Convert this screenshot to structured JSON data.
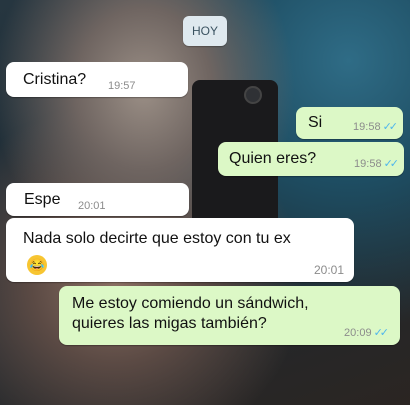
{
  "chat": {
    "date_chip": "HOY",
    "messages": [
      {
        "text": "Cristina?",
        "time": "19:57",
        "direction": "incoming"
      },
      {
        "text": "Si",
        "time": "19:58",
        "direction": "outgoing",
        "ticks": "read"
      },
      {
        "text": "Quien eres?",
        "time": "19:58",
        "direction": "outgoing",
        "ticks": "read"
      },
      {
        "text": "Espe",
        "time": "20:01",
        "direction": "incoming"
      },
      {
        "text": "Nada solo decirte que estoy con tu ex",
        "emoji": "😂",
        "time": "20:01",
        "direction": "incoming"
      },
      {
        "line1": "Me estoy comiendo un sándwich,",
        "line2": "quieres las migas también?",
        "time": "20:09",
        "direction": "outgoing",
        "ticks": "read"
      }
    ]
  },
  "colors": {
    "incoming_bubble": "#ffffff",
    "outgoing_bubble": "#dcf8c6",
    "read_ticks": "#4fb6ec"
  },
  "icons": {
    "read_receipt": "double-check-icon",
    "laugh_emoji": "tears-of-joy-emoji"
  }
}
